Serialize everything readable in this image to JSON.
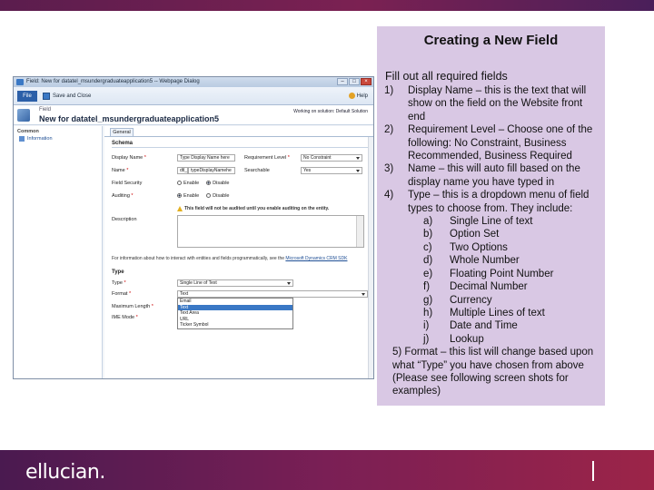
{
  "slide": {
    "title": "Creating a New Field",
    "intro": "Fill out all required fields",
    "steps": [
      {
        "num": "1)",
        "text": "Display Name – this is the text that will show on the field on the Website front end"
      },
      {
        "num": "2)",
        "text": "Requirement Level – Choose one of the following: No Constraint, Business Recommended, Business Required"
      },
      {
        "num": "3)",
        "text": "Name – this will auto fill based on the display name you have typed in"
      },
      {
        "num": "4)",
        "text": "Type – this is a dropdown menu of field types to choose from.  They include:"
      }
    ],
    "types": [
      {
        "num": "a)",
        "text": "Single Line of text"
      },
      {
        "num": "b)",
        "text": "Option Set"
      },
      {
        "num": "c)",
        "text": "Two Options"
      },
      {
        "num": "d)",
        "text": "Whole Number"
      },
      {
        "num": "e)",
        "text": "Floating Point Number"
      },
      {
        "num": "f)",
        "text": "Decimal Number"
      },
      {
        "num": "g)",
        "text": "Currency"
      },
      {
        "num": "h)",
        "text": "Multiple Lines of text"
      },
      {
        "num": "i)",
        "text": "Date and Time"
      },
      {
        "num": "j)",
        "text": "Lookup"
      }
    ],
    "step5": "5) Format – this list will change based upon what “Type” you have chosen from above (Please see following screen shots for examples)"
  },
  "footer": {
    "logo": "ellucian."
  },
  "window": {
    "title": "Field: New for datatel_msundergraduateapplication5 -- Webpage Dialog",
    "file_label": "File",
    "save_close": "Save and Close",
    "help": "Help",
    "field_label": "Field",
    "field_name": "New for datatel_msundergraduateapplication5",
    "solution": "Working on solution: Default Solution",
    "nav_group": "Common",
    "nav_item": "Information",
    "tab": "General",
    "schema": "Schema",
    "display_name_label": "Display Name",
    "display_name_value": "Type Display Name here",
    "requirement_label": "Requirement Level",
    "requirement_value": "No Constraint",
    "name_label": "Name",
    "name_prefix": "dtl_",
    "name_value": "typeDisplayNamehe",
    "searchable_label": "Searchable",
    "searchable_value": "Yes",
    "field_security_label": "Field Security",
    "enable": "Enable",
    "disable": "Disable",
    "auditing_label": "Auditing",
    "audit_warning": "This field will not be audited until you enable auditing on the entity.",
    "description_label": "Description",
    "info_text": "For information about how to interact with entities and fields programmatically, see the",
    "info_link": "Microsoft Dynamics CRM SDK",
    "type_header": "Type",
    "type_label": "Type",
    "type_value": "Single Line of Text",
    "format_label": "Format",
    "format_value": "Text",
    "max_length_label": "Maximum Length",
    "ime_mode_label": "IME Mode",
    "format_options": [
      "Email",
      "Text",
      "Text Area",
      "URL",
      "Ticker Symbol"
    ],
    "format_highlight": 1
  },
  "colors": {
    "panel": "#d9c8e4",
    "bar_start": "#4a1a50",
    "bar_end": "#9c2448"
  }
}
